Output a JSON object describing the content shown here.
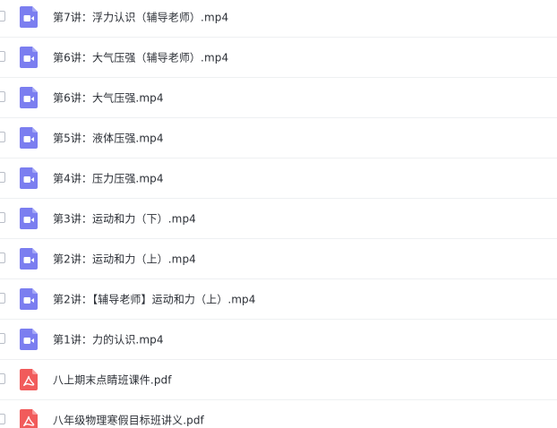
{
  "files": [
    {
      "name": "第7讲：浮力认识（辅导老师）.mp4",
      "type": "video",
      "icon": "video-file-icon"
    },
    {
      "name": "第6讲：大气压强（辅导老师）.mp4",
      "type": "video",
      "icon": "video-file-icon"
    },
    {
      "name": "第6讲：大气压强.mp4",
      "type": "video",
      "icon": "video-file-icon"
    },
    {
      "name": "第5讲：液体压强.mp4",
      "type": "video",
      "icon": "video-file-icon"
    },
    {
      "name": "第4讲：压力压强.mp4",
      "type": "video",
      "icon": "video-file-icon"
    },
    {
      "name": "第3讲：运动和力（下）.mp4",
      "type": "video",
      "icon": "video-file-icon"
    },
    {
      "name": "第2讲：运动和力（上）.mp4",
      "type": "video",
      "icon": "video-file-icon"
    },
    {
      "name": "第2讲：【辅导老师】运动和力（上）.mp4",
      "type": "video",
      "icon": "video-file-icon"
    },
    {
      "name": "第1讲：力的认识.mp4",
      "type": "video",
      "icon": "video-file-icon"
    },
    {
      "name": "八上期末点睛班课件.pdf",
      "type": "pdf",
      "icon": "pdf-file-icon"
    },
    {
      "name": "八年级物理寒假目标班讲义.pdf",
      "type": "pdf",
      "icon": "pdf-file-icon"
    }
  ],
  "colors": {
    "video_icon": "#7b7ef0",
    "pdf_icon": "#f15b5b",
    "text": "#2b2f36",
    "divider": "#eef0f2"
  }
}
